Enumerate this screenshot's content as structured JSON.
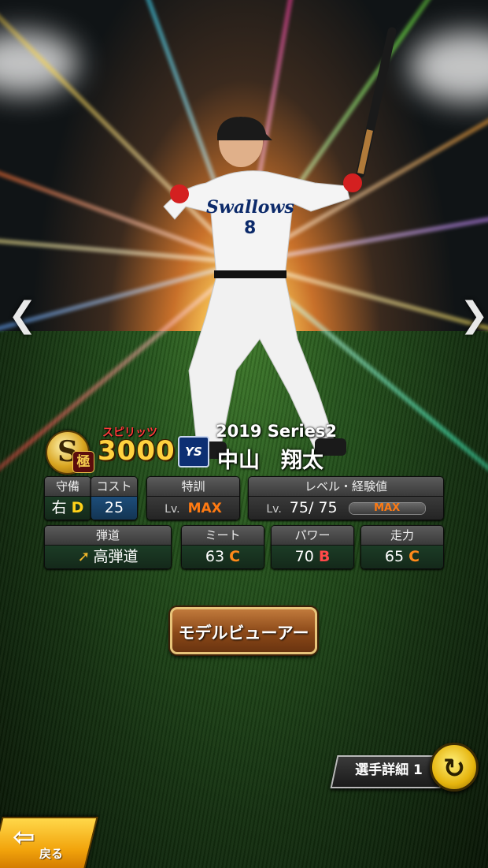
{
  "card": {
    "rank_letter": "S",
    "rank_kanji": "極",
    "spirits_label": "スピリッツ",
    "spirits_value": "3000",
    "team_logo_text": "YS",
    "series": "2019 Series2",
    "player_name": "中山　翔太"
  },
  "stats": {
    "defense": {
      "label": "守備",
      "position": "右",
      "grade": "D"
    },
    "cost": {
      "label": "コスト",
      "value": "25"
    },
    "training": {
      "label": "特訓",
      "lv": "Lv.",
      "value": "MAX"
    },
    "level": {
      "label": "レベル・経験値",
      "lv": "Lv.",
      "value": "75/ 75",
      "exp_text": "MAX",
      "exp_fraction": 1.0
    },
    "trajectory": {
      "label": "弾道",
      "value": "高弾道"
    },
    "contact": {
      "label": "ミート",
      "value": "63",
      "grade": "C"
    },
    "power": {
      "label": "パワー",
      "value": "70",
      "grade": "B"
    },
    "speed": {
      "label": "走力",
      "value": "65",
      "grade": "C"
    }
  },
  "buttons": {
    "model_viewer": "モデルビューアー",
    "player_detail": "選手詳細 1",
    "back": "戻る"
  },
  "icons": {
    "prev": "chevron-left-icon",
    "next": "chevron-right-icon",
    "swap": "swap-arrows-icon",
    "back": "back-arrow-icon",
    "trajectory": "arrow-up-right-icon"
  }
}
